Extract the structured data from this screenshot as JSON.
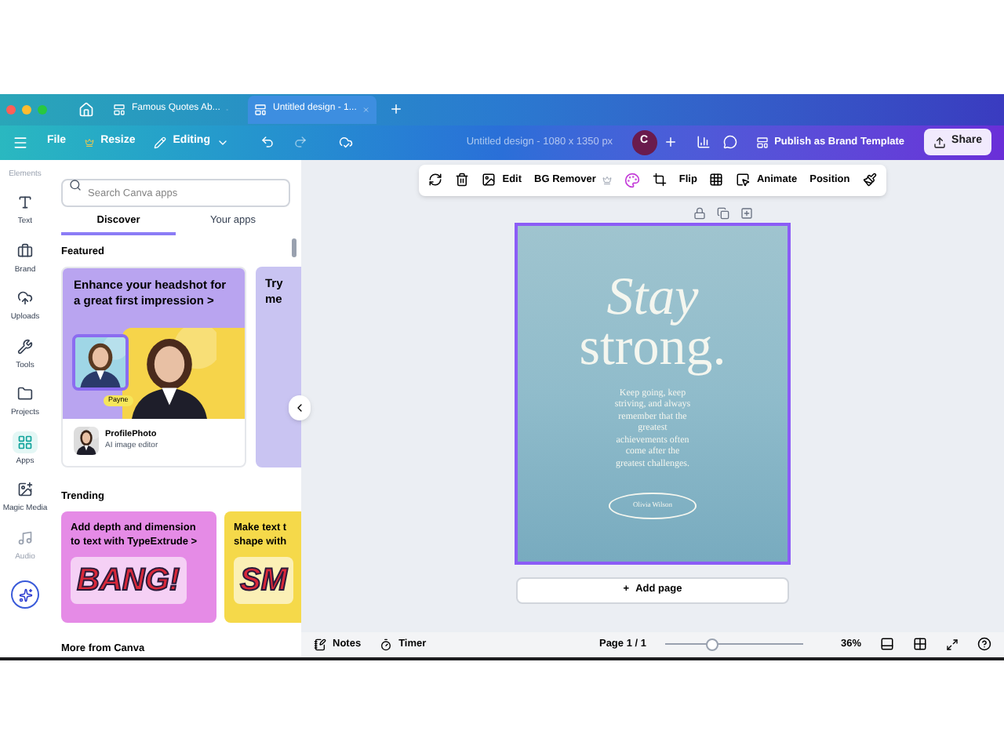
{
  "browser_tabs": [
    {
      "title": "Famous Quotes Ab...",
      "selected": false
    },
    {
      "title": "Untitled design - 1...",
      "selected": true
    }
  ],
  "header": {
    "menu": [
      {
        "label": "File",
        "kind": "plain"
      },
      {
        "label": "Resize",
        "kind": "resize"
      },
      {
        "label": "Editing",
        "kind": "mode"
      }
    ],
    "design_title": "Untitled design - 1080 x 1350 px",
    "avatar": "C",
    "publish": "Publish as Brand Template",
    "share": "Share"
  },
  "rail": {
    "top_label": "Elements",
    "items": [
      {
        "label": "Text",
        "selected": false
      },
      {
        "label": "Brand",
        "selected": false
      },
      {
        "label": "Uploads",
        "selected": false
      },
      {
        "label": "Tools",
        "selected": false
      },
      {
        "label": "Projects",
        "selected": false
      },
      {
        "label": "Apps",
        "selected": true
      },
      {
        "label": "Magic Media",
        "selected": false
      },
      {
        "label": "Audio",
        "selected": false
      }
    ]
  },
  "panel": {
    "search": {
      "placeholder": "Search Canva apps"
    },
    "tabs": [
      {
        "label": "Discover",
        "selected": true
      },
      {
        "label": "Your apps",
        "selected": false
      }
    ],
    "featured": {
      "heading": "Featured",
      "card": {
        "title": "Enhance your headshot for a great first impression",
        "chevron": ">",
        "tag": "Payne",
        "app_name": "ProfilePhoto",
        "app_desc": "AI image editor"
      },
      "next_card_title": "Try\nme"
    },
    "trending": {
      "heading": "Trending",
      "cards": [
        {
          "title": "Add depth and dimension to text with TypeExtrude",
          "chevron": ">",
          "art": "BANG!",
          "color": "#e58be6"
        },
        {
          "title": "Make text t\nshape with",
          "art": "SM",
          "color": "#f5d94a"
        }
      ]
    },
    "more_heading": "More from Canva"
  },
  "toolbar": [
    "Edit",
    "BG Remover",
    "Flip",
    "Animate",
    "Position"
  ],
  "design": {
    "title_1": "Stay",
    "title_2": "strong.",
    "body": "Keep going, keep striving, and always remember that the greatest achievements often come after the greatest challenges.",
    "signature": "Olivia Wilson"
  },
  "add_page": {
    "plus": "+",
    "label": "Add page"
  },
  "footer": {
    "notes": "Notes",
    "timer": "Timer",
    "page": "Page 1 / 1",
    "zoom": {
      "level": 0.34
    },
    "zoom_text": "36%"
  }
}
